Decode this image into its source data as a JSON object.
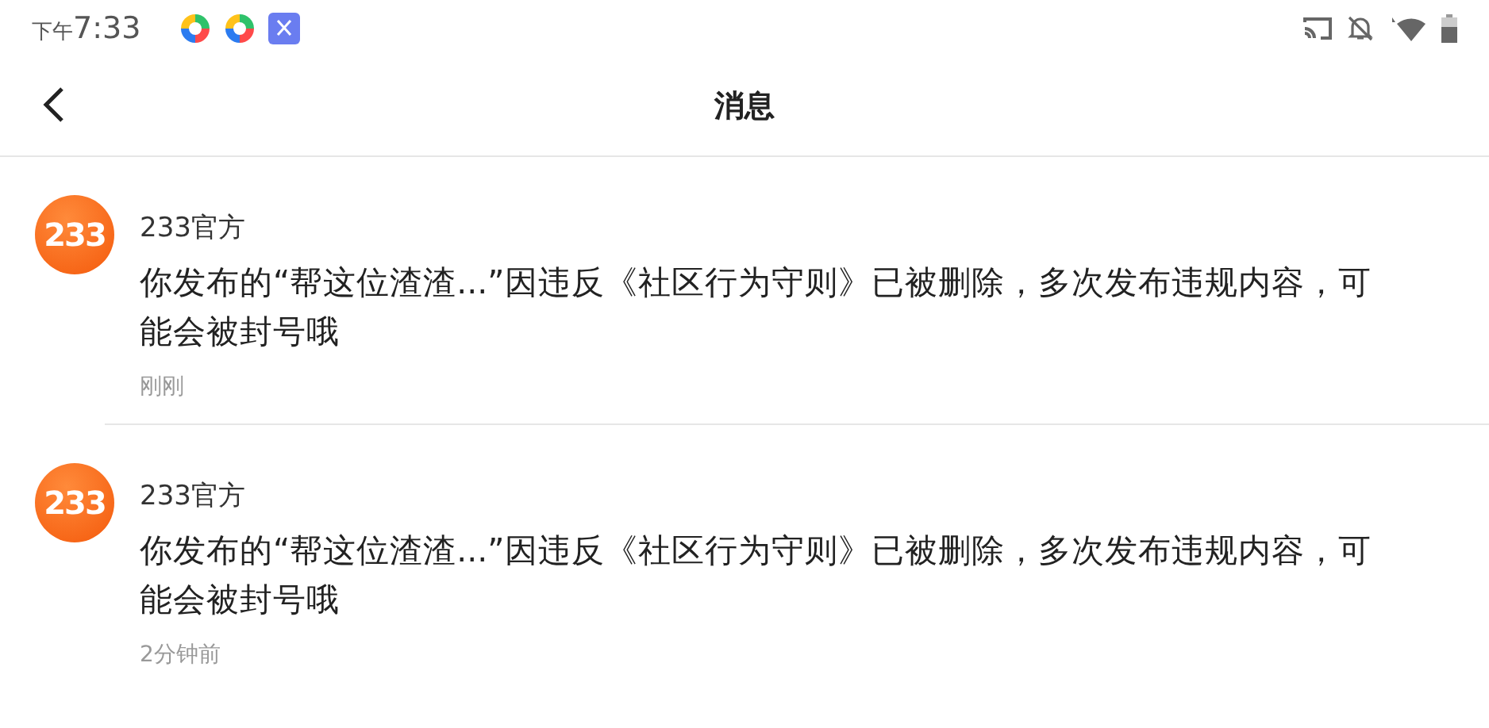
{
  "status_bar": {
    "period": "下午",
    "time": "7:33"
  },
  "header": {
    "title": "消息"
  },
  "messages": [
    {
      "avatar_text": "233",
      "sender": "233官方",
      "body": "你发布的“帮这位渣渣...”因违反《社区行为守则》已被删除，多次发布违规内容，可能会被封号哦",
      "time": "刚刚"
    },
    {
      "avatar_text": "233",
      "sender": "233官方",
      "body": "你发布的“帮这位渣渣...”因违反《社区行为守则》已被删除，多次发布违规内容，可能会被封号哦",
      "time": "2分钟前"
    }
  ]
}
